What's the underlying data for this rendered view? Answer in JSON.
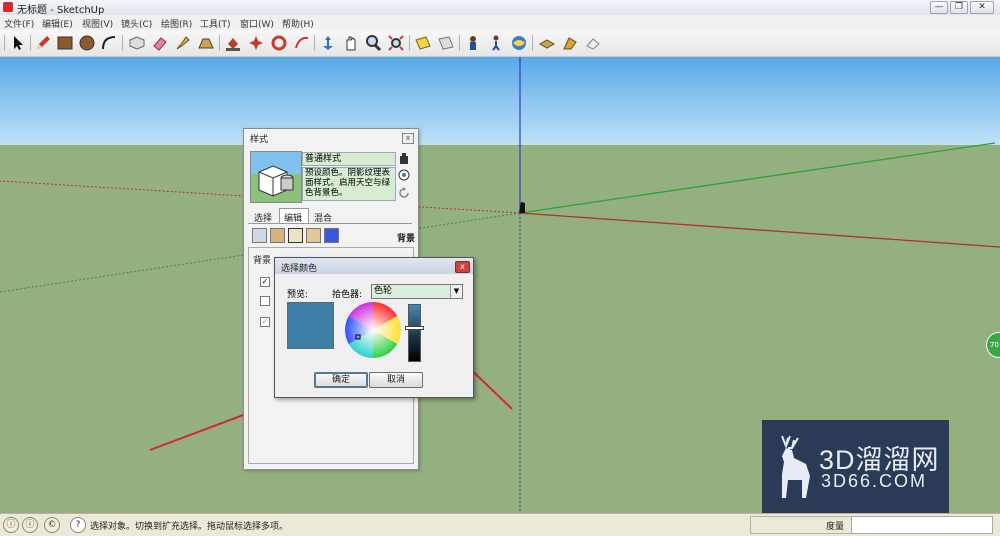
{
  "window": {
    "title": "无标题 - SketchUp",
    "controls": {
      "minimize": "—",
      "restore": "❐",
      "close": "✕"
    }
  },
  "menu": [
    "文件(F)",
    "编辑(E)",
    "视图(V)",
    "镜头(C)",
    "绘图(R)",
    "工具(T)",
    "窗口(W)",
    "帮助(H)"
  ],
  "toolbar_icons": [
    "select-icon",
    "pencil-icon",
    "rectangle-icon",
    "circle-icon",
    "arc-icon",
    "push-pull-icon",
    "eraser-icon",
    "move-icon",
    "tape-measure-icon",
    "paint-bucket-icon",
    "rotate-icon",
    "follow-me-icon",
    "scale-icon",
    "orbit-icon",
    "pan-icon",
    "zoom-icon",
    "zoom-extents-icon",
    "section-plane-icon",
    "section-display-icon",
    "position-camera-icon",
    "walk-icon",
    "look-around-icon",
    "components-icon",
    "warehouse-icon",
    "share-model-icon",
    "extension-icon"
  ],
  "styles_panel": {
    "title": "样式",
    "close": "x",
    "style_name": "普通样式",
    "style_description": "预设颜色。阴影纹理表面样式。启用天空与绿色背景色。",
    "tabs": [
      "选择",
      "编辑",
      "混合"
    ],
    "active_tab": "编辑",
    "section_label": "背景",
    "body_label": "背景",
    "checks": [
      "✓",
      "",
      "✓"
    ]
  },
  "color_dialog": {
    "title": "选择颜色",
    "close": "x",
    "preview_label": "预览:",
    "picker_label": "拾色器:",
    "picker_value": "色轮",
    "picker_arrow": "▼",
    "swatch_color": "#3f7ea6",
    "ok_label": "确定",
    "cancel_label": "取消"
  },
  "status_bar": {
    "text": "选择对象。切换到扩充选择。拖动鼠标选择多项。",
    "measure_label": "度量",
    "measure_value": ""
  },
  "watermark": {
    "line1": "3D溜溜网",
    "line2": "3D66.COM"
  },
  "badge": "70",
  "colors": {
    "sky_top": "#5aa9e8",
    "ground": "#94b07e",
    "arrow": "#d12b2b",
    "axis_red": "#b5302b",
    "axis_green": "#2aa33a",
    "axis_blue": "#2b3fc9"
  }
}
